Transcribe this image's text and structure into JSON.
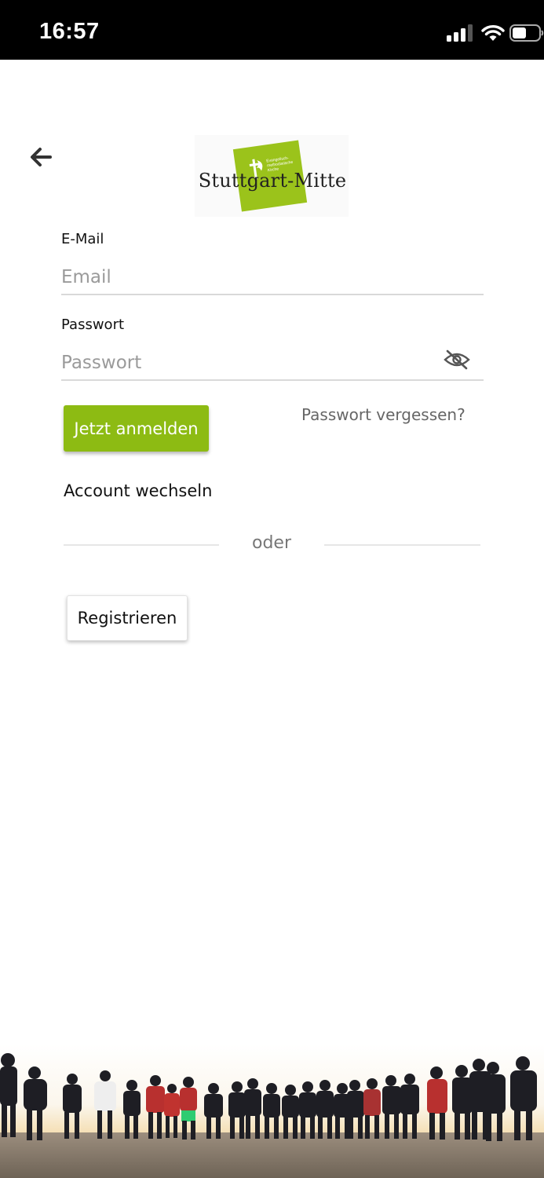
{
  "status_bar": {
    "time": "16:57",
    "icons": [
      "signal-icon",
      "wifi-icon",
      "battery-icon"
    ]
  },
  "header": {
    "back_icon": "arrow-left-icon",
    "logo": {
      "wordmark": "Stuttgart-Mitte",
      "badge_text": "Evangelisch-methodistische Kirche",
      "color": "#9bc31b"
    }
  },
  "form": {
    "email": {
      "label": "E-Mail",
      "placeholder": "Email",
      "value": ""
    },
    "password": {
      "label": "Passwort",
      "placeholder": "Passwort",
      "value": "",
      "toggle_icon": "eye-off-icon"
    },
    "login_label": "Jetzt anmelden",
    "forgot_label": "Passwort vergessen?",
    "switch_account_label": "Account wechseln",
    "divider_label": "oder",
    "register_label": "Registrieren"
  },
  "colors": {
    "accent": "#8dbb13",
    "status_bar": "#000000",
    "input_border": "#d9d9d9"
  }
}
